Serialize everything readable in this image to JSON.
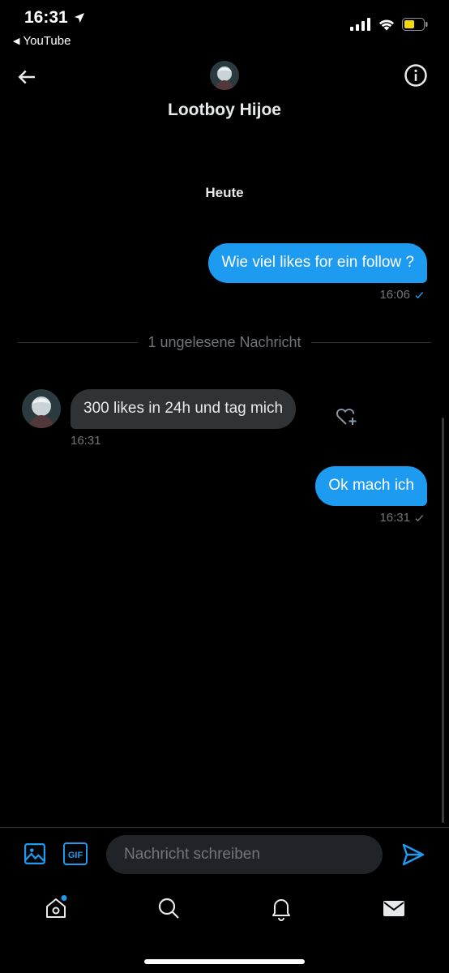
{
  "status_bar": {
    "time": "16:31",
    "back_app": "YouTube"
  },
  "header": {
    "name": "Lootboy Hijoe"
  },
  "conversation": {
    "date_label": "Heute",
    "unread_label": "1 ungelesene Nachricht",
    "messages": [
      {
        "direction": "outgoing",
        "text": "Wie viel likes for ein follow ?",
        "time": "16:06"
      },
      {
        "direction": "incoming",
        "text": "300 likes in 24h und tag mich",
        "time": "16:31"
      },
      {
        "direction": "outgoing",
        "text": "Ok mach ich",
        "time": "16:31"
      }
    ]
  },
  "composer": {
    "placeholder": "Nachricht schreiben",
    "value": ""
  },
  "icons": {
    "back": "arrow-left-icon",
    "info": "info-icon",
    "media": "image-icon",
    "gif": "gif-icon",
    "send": "send-icon",
    "like": "heart-plus-icon",
    "nav": [
      "home-icon",
      "search-icon",
      "bell-icon",
      "mail-icon"
    ]
  },
  "colors": {
    "accent": "#1d9bf0",
    "background": "#000000",
    "incoming_bubble": "#2f3336",
    "muted_text": "#71767b",
    "battery": "#f5d90a"
  }
}
